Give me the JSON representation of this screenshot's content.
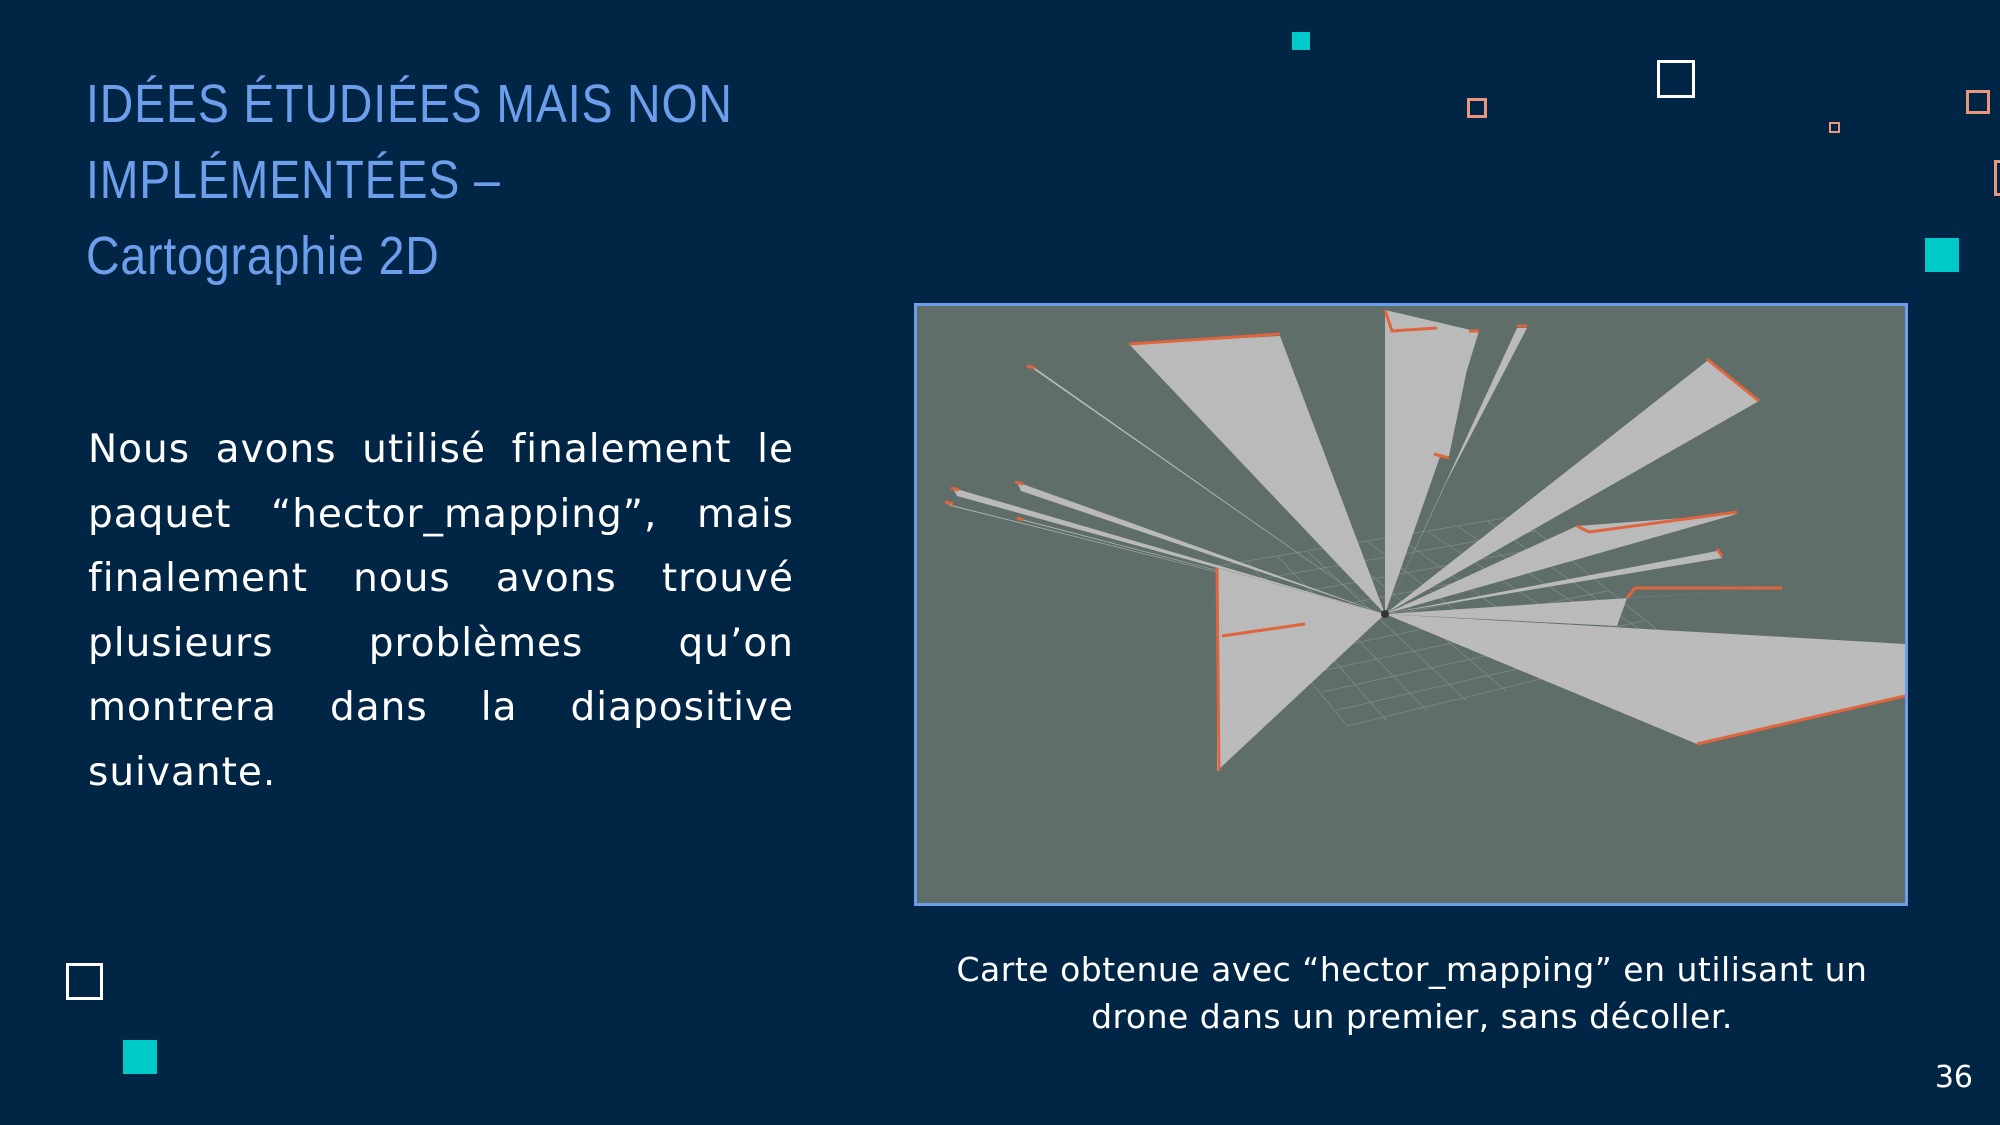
{
  "slide": {
    "title_line1": "IDÉES ÉTUDIÉES MAIS NON IMPLÉMENTÉES –",
    "title_line2": "Cartographie 2D",
    "body": "Nous avons utilisé finalement le paquet “hector_mapping”, mais finalement nous avons trouvé plusieurs problèmes qu’on montrera dans la diapositive suivante.",
    "caption_line1": "Carte obtenue avec “hector_mapping” en utilisant un",
    "caption_line2": "drone dans un premier, sans décoller.",
    "page_number": "36"
  },
  "colors": {
    "background": "#012645",
    "title": "#6d9eeb",
    "accent_teal": "#00c9c9",
    "accent_orange": "#e9977f",
    "figure_border": "#6d9eeb",
    "map_background": "#5f6e69",
    "map_free_space": "#bfbfbf",
    "map_obstacle": "#e0643c"
  }
}
